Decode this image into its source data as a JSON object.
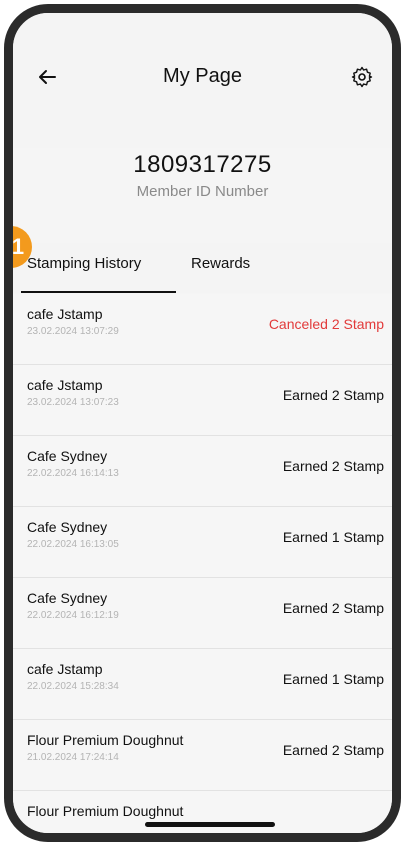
{
  "header": {
    "title": "My Page",
    "back_icon": "arrow-left-icon",
    "settings_icon": "gear-icon"
  },
  "member": {
    "id_number": "1809317275",
    "label": "Member ID Number"
  },
  "step_badge": "1",
  "tabs": [
    {
      "label": "Stamping History",
      "active": true
    },
    {
      "label": "Rewards",
      "active": false
    }
  ],
  "history": [
    {
      "name": "cafe Jstamp",
      "date": "23.02.2024 13:07:29",
      "status": "Canceled 2 Stamp",
      "type": "canceled"
    },
    {
      "name": "cafe Jstamp",
      "date": "23.02.2024 13:07:23",
      "status": "Earned 2 Stamp",
      "type": "earned"
    },
    {
      "name": "Cafe Sydney",
      "date": "22.02.2024 16:14:13",
      "status": "Earned 2 Stamp",
      "type": "earned"
    },
    {
      "name": "Cafe Sydney",
      "date": "22.02.2024 16:13:05",
      "status": "Earned 1 Stamp",
      "type": "earned"
    },
    {
      "name": "Cafe Sydney",
      "date": "22.02.2024 16:12:19",
      "status": "Earned 2 Stamp",
      "type": "earned"
    },
    {
      "name": "cafe Jstamp",
      "date": "22.02.2024 15:28:34",
      "status": "Earned 1 Stamp",
      "type": "earned"
    },
    {
      "name": "Flour Premium Doughnut",
      "date": "21.02.2024 17:24:14",
      "status": "Earned 2 Stamp",
      "type": "earned"
    },
    {
      "name": "Flour Premium Doughnut",
      "date": "",
      "status": "",
      "type": "earned"
    }
  ],
  "colors": {
    "accent": "#f39a1d",
    "canceled": "#e23a3a",
    "frame": "#2b2b2b"
  }
}
